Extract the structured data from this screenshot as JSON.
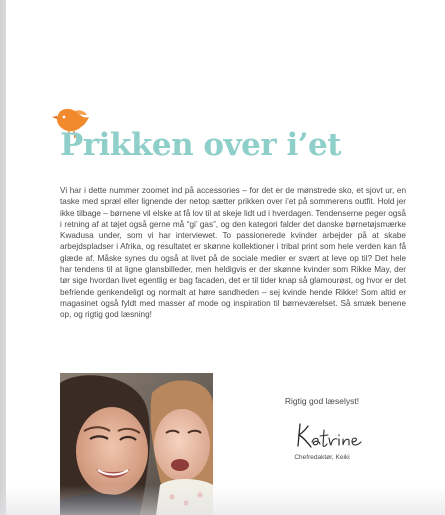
{
  "article": {
    "title": "Prikken over i’et",
    "body": "Vi har i dette nummer zoomet ind på accessories – for det er de mønstrede sko, et sjovt ur, en taske med spræl eller lignende der netop sætter prikken over i’et på sommerens outfit. Hold jer ikke tilbage – børnene vil elske at få lov til at skeje lidt ud i hverdagen. Tendenserne peger også i retning af at tøjet også gerne må “gi’ gas”, og den kategori falder det danske børnetøjsmærke Kwadusa under, som vi har interviewet. To passionerede kvinder arbejder på at skabe arbejdspladser i Afrika, og resultatet er skønne kollektioner i tribal print som hele verden kan få glæde af. Måske synes du også at livet på de sociale medier er svært at leve op til? Det hele har tendens til at ligne glansbilleder, men heldigvis er der skønne kvinder som Rikke May, der tør sige hvordan livet egentlig er bag facaden, det er til tider knap så glamourøst, og hvor er det befriende genkendeligt og normalt at høre sandheden – sej kvinde hende Rikke! Som altid er magasinet også fyldt med masser af mode og inspiration til børneværelset.  Så smæk benene op, og rigtig god læsning!",
    "greeting": "Rigtig god læselyst!",
    "signature_name": "Katrine",
    "signature_role": "Chefredaktør, Keiki"
  },
  "icons": {
    "bird": "bird-icon"
  },
  "colors": {
    "title": "#8fcfc9",
    "bird": "#f08a2c",
    "text": "#4a4a4a"
  }
}
